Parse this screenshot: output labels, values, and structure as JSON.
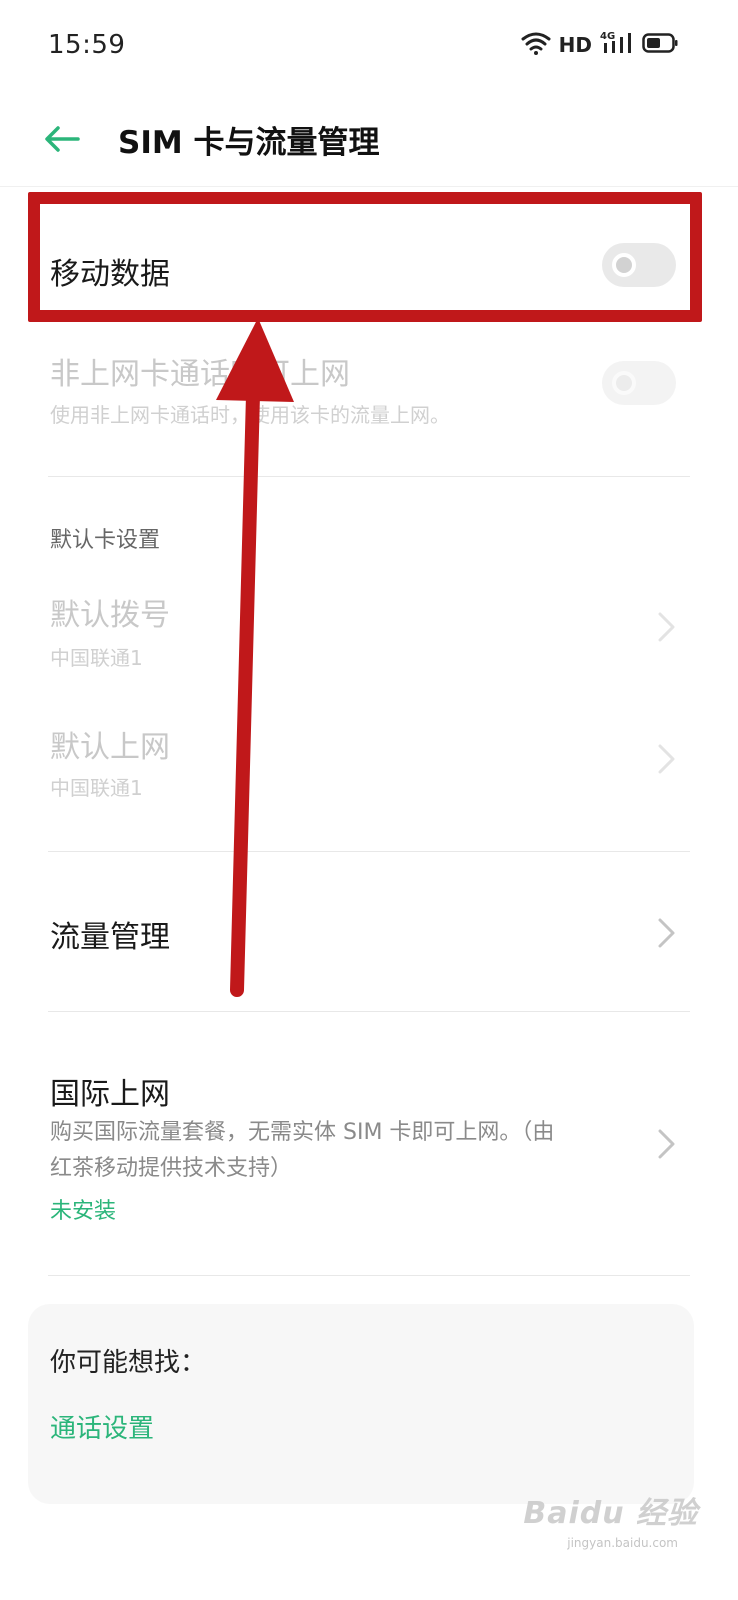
{
  "status_bar": {
    "time": "15:59",
    "network": "HD",
    "network_type": "4G"
  },
  "header": {
    "title": "SIM 卡与流量管理"
  },
  "rows": {
    "mobile_data": {
      "title": "移动数据",
      "enabled": false
    },
    "non_data_card": {
      "title": "非上网卡通话时可上网",
      "subtitle": "使用非上网卡通话时，使用该卡的流量上网。",
      "enabled": false,
      "disabled": true
    },
    "default_section_label": "默认卡设置",
    "default_dial": {
      "title": "默认拨号",
      "value": "中国联通1"
    },
    "default_data": {
      "title": "默认上网",
      "value": "中国联通1"
    },
    "data_management": {
      "title": "流量管理"
    },
    "international": {
      "title": "国际上网",
      "description_line1": "购买国际流量套餐，无需实体 SIM 卡即可上网。（由",
      "description_line2": "红茶移动提供技术支持）",
      "status": "未安装"
    }
  },
  "suggestions": {
    "title": "你可能想找：",
    "link": "通话设置"
  },
  "watermark": {
    "text": "Baidu 经验",
    "sub": "jingyan.baidu.com"
  },
  "colors": {
    "accent": "#2bb57a",
    "annotation": "#c0181a"
  }
}
